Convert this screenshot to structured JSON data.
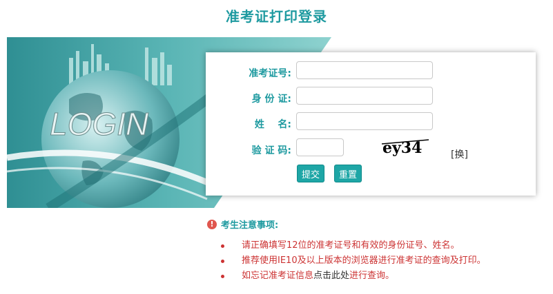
{
  "page": {
    "title": "准考证打印登录"
  },
  "banner": {
    "text": "LOGIN"
  },
  "form": {
    "exam_no": {
      "label": "准考证号:",
      "value": ""
    },
    "id_no": {
      "label": "身 份 证:",
      "value": ""
    },
    "name": {
      "label": "姓    名:",
      "value": ""
    },
    "code": {
      "label": "验 证 码:",
      "value": ""
    },
    "captcha_text": "ey34",
    "swap_label": "[换]",
    "submit_label": "提交",
    "reset_label": "重置"
  },
  "notice": {
    "icon": "!",
    "title": "考生注意事项:",
    "items": [
      "请正确填写12位的准考证号和有效的身份证号、姓名。",
      "推荐使用IE10及以上版本的浏览器进行准考证的查询及打印。"
    ],
    "item3_prefix": "如忘记准考证信息",
    "item3_link": "点击此处",
    "item3_suffix": "进行查询。"
  },
  "colors": {
    "accent": "#1e9aa0",
    "button": "#1ea6a6",
    "notice_text": "#cc3333",
    "notice_icon": "#e0564e"
  }
}
